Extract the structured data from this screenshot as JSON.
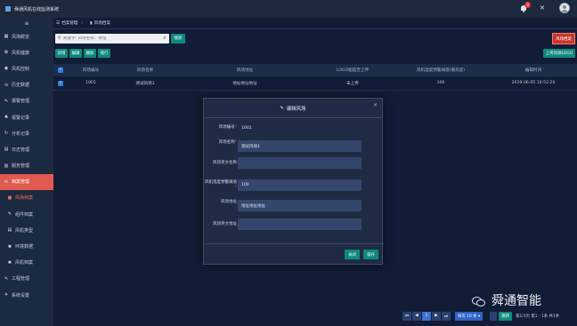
{
  "topbar": {
    "title": "舜通风机在线监测系统",
    "notification_count": "3"
  },
  "sidebar": {
    "menu_icon": "≡",
    "items": [
      {
        "label": "风场概览",
        "icon": "grid-icon",
        "glyph": "▦",
        "active": false,
        "sub": false
      },
      {
        "label": "风机健康",
        "icon": "gear-icon",
        "glyph": "✿",
        "active": false,
        "sub": false
      },
      {
        "label": "风机控制",
        "icon": "control-icon",
        "glyph": "◉",
        "active": false,
        "sub": false
      },
      {
        "label": "历史数据",
        "icon": "history-icon",
        "glyph": "⊙",
        "active": false,
        "sub": false
      },
      {
        "label": "报警管理",
        "icon": "wrench-icon",
        "glyph": "✎",
        "active": false,
        "sub": false
      },
      {
        "label": "报警记录",
        "icon": "bell-icon",
        "glyph": "♣",
        "active": false,
        "sub": false
      },
      {
        "label": "分析记录",
        "icon": "refresh-icon",
        "glyph": "↻",
        "active": false,
        "sub": false
      },
      {
        "label": "日志管理",
        "icon": "log-icon",
        "glyph": "▤",
        "active": false,
        "sub": false
      },
      {
        "label": "服务管理",
        "icon": "server-icon",
        "glyph": "▥",
        "active": false,
        "sub": false
      },
      {
        "label": "档案管理",
        "icon": "archive-icon",
        "glyph": "✉",
        "active": true,
        "sub": false
      },
      {
        "label": "风场档案",
        "icon": "list-icon",
        "glyph": "■",
        "active": true,
        "sub": true
      },
      {
        "label": "组件档案",
        "icon": "component-icon",
        "glyph": "✎",
        "active": false,
        "sub": true
      },
      {
        "label": "风机类型",
        "icon": "type-icon",
        "glyph": "▤",
        "active": false,
        "sub": true
      },
      {
        "label": "环境数据",
        "icon": "environment-icon",
        "glyph": "✺",
        "active": false,
        "sub": true
      },
      {
        "label": "风机档案",
        "icon": "fan-icon",
        "glyph": "✱",
        "active": false,
        "sub": true
      },
      {
        "label": "工程管理",
        "icon": "project-icon",
        "glyph": "✎",
        "active": false,
        "sub": false
      },
      {
        "label": "系统设置",
        "icon": "settings-icon",
        "glyph": "✈",
        "active": false,
        "sub": false
      }
    ]
  },
  "breadcrumb": {
    "items": [
      {
        "label": "档案管理",
        "icon": "list-icon"
      },
      {
        "label": "风场档案",
        "icon": "folder-icon"
      }
    ]
  },
  "search": {
    "value": "",
    "placeholder": "关键字: 风场名称、地址",
    "button_label": "搜索"
  },
  "alarm_button": "风场档案",
  "toolbar": {
    "buttons": [
      "新增",
      "编辑",
      "删除",
      "排行"
    ],
    "upload_label": "上传风场LOGO"
  },
  "table": {
    "columns": [
      "风场编号",
      "风场名称",
      "风场地址",
      "LOGO图是否上传",
      "风机温度预警阈值(摄氏度)",
      "编辑时间"
    ],
    "rows": [
      {
        "checked": true,
        "cells": [
          "1001",
          "测试风场1",
          "地址地址地址",
          "未上传",
          "100",
          "2019-06-05 10:52:20"
        ]
      }
    ]
  },
  "modal": {
    "title": "编辑风场",
    "fields": [
      {
        "label": "风场编号",
        "required": true,
        "value": "1001",
        "type": "text"
      },
      {
        "label": "风场名称",
        "required": true,
        "value": "测试风场1",
        "type": "input"
      },
      {
        "label": "风场英文名称",
        "required": false,
        "value": "",
        "type": "input"
      },
      {
        "label": "风机温度预警阈值",
        "required": true,
        "value": "100",
        "type": "input"
      },
      {
        "label": "风场地址",
        "required": false,
        "value": "地址地址地址",
        "type": "input"
      },
      {
        "label": "风场英文地址",
        "required": false,
        "value": "",
        "type": "input"
      }
    ],
    "close_label": "关闭",
    "save_label": "保存"
  },
  "pagination": {
    "buttons": [
      "⏮",
      "◀",
      "1",
      "▶",
      "⏭"
    ],
    "active_page": "1",
    "page_size": "每页 10 条 ▾",
    "go_label": "跳转",
    "summary": "第1/1页 第1 - 1条 共1条"
  },
  "watermark": {
    "text": "舜通智能"
  },
  "colors": {
    "accent_teal": "#0e8a7c",
    "active_red": "#e05a4f",
    "sidebar_bg": "#1b2a40",
    "main_bg": "#111d36"
  }
}
